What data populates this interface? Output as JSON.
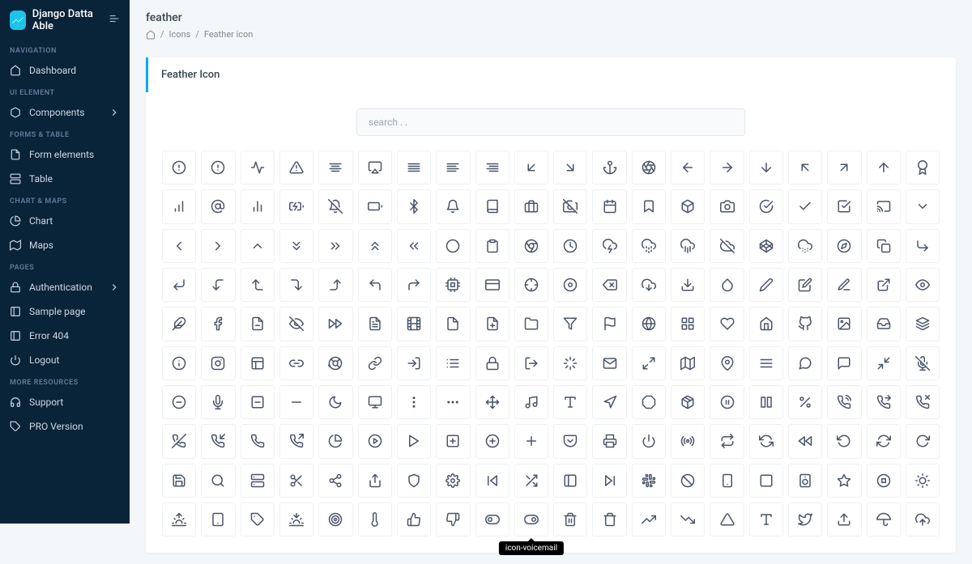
{
  "app": {
    "name": "Django Datta Able"
  },
  "page": {
    "title": "feather",
    "card_title": "Feather Icon"
  },
  "breadcrumb": {
    "home": "Home",
    "icons": "Icons",
    "current": "Feather icon"
  },
  "search": {
    "placeholder": "search . ."
  },
  "nav": {
    "sections": [
      {
        "label": "NAVIGATION",
        "items": [
          {
            "label": "Dashboard",
            "icon": "home"
          }
        ]
      },
      {
        "label": "UI ELEMENT",
        "items": [
          {
            "label": "Components",
            "icon": "box",
            "chevron": true
          }
        ]
      },
      {
        "label": "FORMS & TABLE",
        "items": [
          {
            "label": "Form elements",
            "icon": "file-text"
          },
          {
            "label": "Table",
            "icon": "server"
          }
        ]
      },
      {
        "label": "CHART & MAPS",
        "items": [
          {
            "label": "Chart",
            "icon": "pie-chart"
          },
          {
            "label": "Maps",
            "icon": "map"
          }
        ]
      },
      {
        "label": "PAGES",
        "items": [
          {
            "label": "Authentication",
            "icon": "lock",
            "chevron": true
          },
          {
            "label": "Sample page",
            "icon": "sidebar"
          },
          {
            "label": "Error 404",
            "icon": "sidebar"
          },
          {
            "label": "Logout",
            "icon": "power"
          }
        ]
      },
      {
        "label": "MORE RESOURCES",
        "items": [
          {
            "label": "Support",
            "icon": "headphones"
          },
          {
            "label": "PRO Version",
            "icon": "tag"
          }
        ]
      }
    ]
  },
  "tooltip": {
    "visible_on": "icon-voicemail",
    "label": "icon-voicemail"
  },
  "icons": [
    "alert-circle",
    "alert-circle",
    "activity",
    "alert-triangle",
    "align-center",
    "airplay",
    "align-justify",
    "align-left",
    "align-right",
    "arrow-down-left",
    "arrow-down-right",
    "anchor",
    "aperture",
    "arrow-left",
    "arrow-right",
    "arrow-down",
    "arrow-up-left",
    "arrow-up-right",
    "arrow-up",
    "award",
    "bar-chart",
    "at-sign",
    "bar-chart-2",
    "battery-charging",
    "bell-off",
    "battery",
    "bluetooth",
    "bell",
    "book",
    "briefcase",
    "camera-off",
    "calendar",
    "bookmark",
    "box",
    "camera",
    "check-circle",
    "check",
    "check-square",
    "cast",
    "chevron-down",
    "chevron-left",
    "chevron-right",
    "chevron-up",
    "chevrons-down",
    "chevrons-right",
    "chevrons-up",
    "chevrons-left",
    "circle",
    "clipboard",
    "chrome",
    "clock",
    "cloud-lightning",
    "cloud-drizzle",
    "cloud-rain",
    "cloud-off",
    "codepen",
    "cloud-snow",
    "compass",
    "copy",
    "corner-down-right",
    "corner-down-left",
    "corner-left-down",
    "corner-left-up",
    "corner-right-down",
    "corner-right-up",
    "corner-up-left",
    "corner-up-right",
    "cpu",
    "credit-card",
    "crosshair",
    "disc",
    "delete",
    "download-cloud",
    "download",
    "droplet",
    "edit-2",
    "edit",
    "edit-3",
    "external-link",
    "eye",
    "feather",
    "facebook",
    "file-minus",
    "eye-off",
    "fast-forward",
    "file-text",
    "film",
    "file",
    "file-plus",
    "folder",
    "filter",
    "flag",
    "globe",
    "grid",
    "heart",
    "home",
    "github",
    "image",
    "inbox",
    "layers",
    "info",
    "instagram",
    "layout",
    "link-2",
    "life-buoy",
    "link",
    "log-in",
    "list",
    "lock",
    "log-out",
    "loader",
    "mail",
    "maximize-2",
    "map",
    "map-pin",
    "menu",
    "message-circle",
    "message-square",
    "minimize-2",
    "mic-off",
    "minus-circle",
    "mic",
    "minus-square",
    "minus",
    "moon",
    "monitor",
    "more-vertical",
    "more-horizontal",
    "move",
    "music",
    "type",
    "navigation",
    "octagon",
    "package",
    "pause-circle",
    "columns",
    "percent",
    "phone-call",
    "phone-forwarded",
    "phone-missed",
    "phone-off",
    "phone-incoming",
    "phone",
    "phone-outgoing",
    "pie-chart",
    "play-circle",
    "play",
    "plus-square",
    "plus-circle",
    "plus",
    "pocket",
    "printer",
    "power",
    "radio",
    "repeat",
    "refresh-ccw",
    "rewind",
    "rotate-ccw",
    "refresh-cw",
    "rotate-cw",
    "save",
    "search",
    "server",
    "scissors",
    "share-2",
    "share",
    "shield",
    "settings",
    "skip-back",
    "shuffle",
    "sidebar",
    "skip-forward",
    "slack",
    "slash",
    "smartphone",
    "square",
    "speaker",
    "star",
    "stop-circle",
    "sun",
    "sunrise",
    "tablet",
    "tag",
    "sunset",
    "target",
    "thermometer",
    "thumbs-up",
    "thumbs-down",
    "toggle-left",
    "toggle-right",
    "trash-2",
    "trash",
    "trending-up",
    "trending-down",
    "triangle",
    "type",
    "twitter",
    "upload",
    "umbrella",
    "upload-cloud"
  ]
}
